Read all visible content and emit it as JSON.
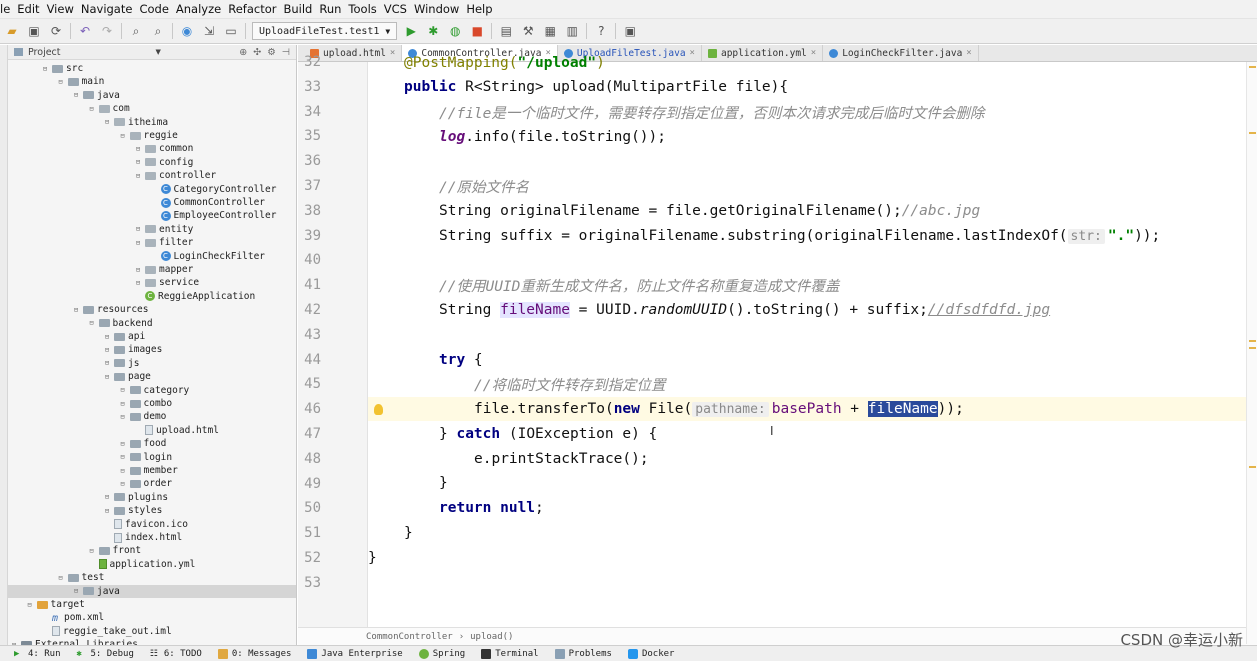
{
  "menu": [
    "le",
    "Edit",
    "View",
    "Navigate",
    "Code",
    "Analyze",
    "Refactor",
    "Build",
    "Run",
    "Tools",
    "VCS",
    "Window",
    "Help"
  ],
  "toolbar": {
    "run_config": "UploadFileTest.test1"
  },
  "project": {
    "title": "Project",
    "tree": [
      {
        "label": "src",
        "depth": 2,
        "kind": "folder"
      },
      {
        "label": "main",
        "depth": 3,
        "kind": "folder"
      },
      {
        "label": "java",
        "depth": 4,
        "kind": "folder"
      },
      {
        "label": "com",
        "depth": 5,
        "kind": "pkg"
      },
      {
        "label": "itheima",
        "depth": 6,
        "kind": "pkg"
      },
      {
        "label": "reggie",
        "depth": 7,
        "kind": "pkg"
      },
      {
        "label": "common",
        "depth": 8,
        "kind": "pkg"
      },
      {
        "label": "config",
        "depth": 8,
        "kind": "pkg"
      },
      {
        "label": "controller",
        "depth": 8,
        "kind": "pkg"
      },
      {
        "label": "CategoryController",
        "depth": 9,
        "kind": "class"
      },
      {
        "label": "CommonController",
        "depth": 9,
        "kind": "class"
      },
      {
        "label": "EmployeeController",
        "depth": 9,
        "kind": "class"
      },
      {
        "label": "entity",
        "depth": 8,
        "kind": "pkg"
      },
      {
        "label": "filter",
        "depth": 8,
        "kind": "pkg"
      },
      {
        "label": "LoginCheckFilter",
        "depth": 9,
        "kind": "class"
      },
      {
        "label": "mapper",
        "depth": 8,
        "kind": "pkg"
      },
      {
        "label": "service",
        "depth": 8,
        "kind": "pkg"
      },
      {
        "label": "ReggieApplication",
        "depth": 8,
        "kind": "spring"
      },
      {
        "label": "resources",
        "depth": 4,
        "kind": "folder"
      },
      {
        "label": "backend",
        "depth": 5,
        "kind": "folder"
      },
      {
        "label": "api",
        "depth": 6,
        "kind": "folder"
      },
      {
        "label": "images",
        "depth": 6,
        "kind": "folder"
      },
      {
        "label": "js",
        "depth": 6,
        "kind": "folder"
      },
      {
        "label": "page",
        "depth": 6,
        "kind": "folder"
      },
      {
        "label": "category",
        "depth": 7,
        "kind": "folder"
      },
      {
        "label": "combo",
        "depth": 7,
        "kind": "folder"
      },
      {
        "label": "demo",
        "depth": 7,
        "kind": "folder"
      },
      {
        "label": "upload.html",
        "depth": 8,
        "kind": "file"
      },
      {
        "label": "food",
        "depth": 7,
        "kind": "folder"
      },
      {
        "label": "login",
        "depth": 7,
        "kind": "folder"
      },
      {
        "label": "member",
        "depth": 7,
        "kind": "folder"
      },
      {
        "label": "order",
        "depth": 7,
        "kind": "folder"
      },
      {
        "label": "plugins",
        "depth": 6,
        "kind": "folder"
      },
      {
        "label": "styles",
        "depth": 6,
        "kind": "folder"
      },
      {
        "label": "favicon.ico",
        "depth": 6,
        "kind": "file"
      },
      {
        "label": "index.html",
        "depth": 6,
        "kind": "file"
      },
      {
        "label": "front",
        "depth": 5,
        "kind": "folder"
      },
      {
        "label": "application.yml",
        "depth": 5,
        "kind": "yml"
      },
      {
        "label": "test",
        "depth": 3,
        "kind": "folder"
      },
      {
        "label": "java",
        "depth": 4,
        "kind": "folder",
        "selected": true
      },
      {
        "label": "target",
        "depth": 1,
        "kind": "orange"
      },
      {
        "label": "pom.xml",
        "depth": 2,
        "kind": "maven"
      },
      {
        "label": "reggie_take_out.iml",
        "depth": 2,
        "kind": "file"
      },
      {
        "label": "External Libraries",
        "depth": 0,
        "kind": "lib"
      }
    ]
  },
  "tabs": [
    {
      "label": "upload.html",
      "icon": "html",
      "active": false,
      "linked": false
    },
    {
      "label": "CommonController.java",
      "icon": "class",
      "active": true,
      "linked": false
    },
    {
      "label": "UploadFileTest.java",
      "icon": "class",
      "active": false,
      "linked": true
    },
    {
      "label": "application.yml",
      "icon": "yml",
      "active": false,
      "linked": false
    },
    {
      "label": "LoginCheckFilter.java",
      "icon": "class",
      "active": false,
      "linked": false
    }
  ],
  "editor": {
    "line_numbers": [
      "32",
      "33",
      "34",
      "35",
      "36",
      "37",
      "38",
      "39",
      "40",
      "41",
      "42",
      "43",
      "44",
      "45",
      "46",
      "47",
      "48",
      "49",
      "50",
      "51",
      "52",
      "53"
    ],
    "lines": {
      "l32_ann": "@PostMapping(",
      "l32_str": "\"/upload\"",
      "l32_end": ")",
      "l33_kw": "public",
      "l33_rest": " R<String> upload(MultipartFile file){",
      "l34_cm": "//file是一个临时文件，需要转存到指定位置，否则本次请求完成后临时文件会删除",
      "l35_log": "log",
      "l35_rest": ".info(file.toString());",
      "l37_cm": "//原始文件名",
      "l38_code": "String originalFilename = file.getOriginalFilename();",
      "l38_cm": "//abc.jpg",
      "l39_code": "String suffix = originalFilename.substring(originalFilename.lastIndexOf(",
      "l39_hint": "str:",
      "l39_str": "\".\"",
      "l39_end": "));",
      "l41_cm": "//使用UUID重新生成文件名，防止文件名称重复造成文件覆盖",
      "l42_a": "String ",
      "l42_var": "fileName",
      "l42_b": " = UUID.",
      "l42_it": "randomUUID",
      "l42_c": "().toString() + suffix;",
      "l42_cm": "//dfsdfdfd.jpg",
      "l44_kw": "try",
      "l44_rest": " {",
      "l45_cm": "//将临时文件转存到指定位置",
      "l46_a": "file.transferTo(",
      "l46_kw": "new",
      "l46_b": " File(",
      "l46_hint": "pathname:",
      "l46_bp": "basePath",
      "l46_c": " + ",
      "l46_sel": "fileName",
      "l46_d": "));",
      "l47_a": "} ",
      "l47_kw": "catch",
      "l47_b": " (IOException e) {",
      "l48": "e.printStackTrace();",
      "l49": "}",
      "l50_kw": "return",
      "l50_null": " null",
      "l50_end": ";",
      "l51": "}",
      "l52": "}"
    },
    "breadcrumb": [
      "CommonController",
      "upload()"
    ]
  },
  "bottom_tools": [
    "4: Run",
    "5: Debug",
    "6: TODO",
    "0: Messages",
    "Java Enterprise",
    "Spring",
    "Terminal",
    "Problems",
    "Docker"
  ],
  "watermark": "CSDN @幸运小新"
}
